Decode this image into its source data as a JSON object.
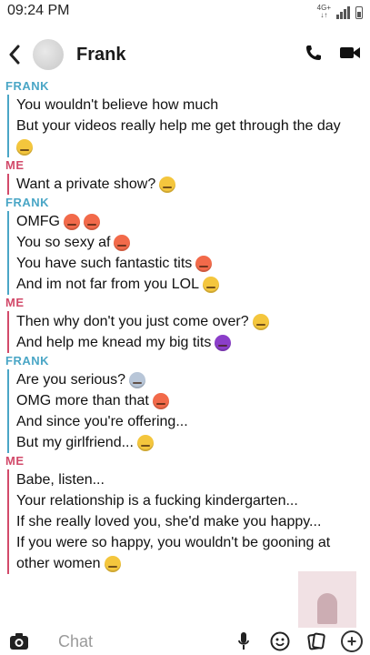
{
  "status_bar": {
    "time": "09:24 PM",
    "network": "4G+"
  },
  "header": {
    "contact_name": "Frank"
  },
  "messages": [
    {
      "sender": "FRANK",
      "from": "frank",
      "lines": [
        {
          "text": "You wouldn't believe how much",
          "emojis": []
        },
        {
          "text": "But your videos really help me get through the day",
          "emojis": []
        },
        {
          "text": "",
          "emojis": [
            "grin"
          ]
        }
      ]
    },
    {
      "sender": "ME",
      "from": "me",
      "lines": [
        {
          "text": "Want a private show?",
          "emojis": [
            "smirk"
          ]
        }
      ]
    },
    {
      "sender": "FRANK",
      "from": "frank",
      "lines": [
        {
          "text": "OMFG",
          "emojis": [
            "flushed",
            "flushed"
          ]
        },
        {
          "text": "You so sexy af",
          "emojis": [
            "flushed"
          ]
        },
        {
          "text": "You have such fantastic tits",
          "emojis": [
            "flushed"
          ]
        },
        {
          "text": "And im not far from you LOL",
          "emojis": [
            "grin"
          ]
        }
      ]
    },
    {
      "sender": "ME",
      "from": "me",
      "lines": [
        {
          "text": "Then why don't you just come over?",
          "emojis": [
            "smirk"
          ]
        },
        {
          "text": "And help me knead my big tits",
          "emojis": [
            "devil"
          ]
        }
      ]
    },
    {
      "sender": "FRANK",
      "from": "frank",
      "lines": [
        {
          "text": "Are you serious?",
          "emojis": [
            "scream"
          ]
        },
        {
          "text": "OMG more than that",
          "emojis": [
            "flushed"
          ]
        },
        {
          "text": "And since you're offering...",
          "emojis": []
        },
        {
          "text": "But my girlfriend...",
          "emojis": [
            "grimace"
          ]
        }
      ]
    },
    {
      "sender": "ME",
      "from": "me",
      "lines": [
        {
          "text": "Babe, listen...",
          "emojis": []
        },
        {
          "text": "Your relationship is a fucking kindergarten...",
          "emojis": []
        },
        {
          "text": "If she really loved you, she'd make you happy...",
          "emojis": []
        },
        {
          "text": "If you were so happy, you wouldn't be gooning at",
          "emojis": []
        },
        {
          "text": "other women",
          "emojis": [
            "smirk"
          ]
        }
      ]
    }
  ],
  "chat_bar": {
    "placeholder": "Chat"
  },
  "icons": {
    "back": "chevron-left-icon",
    "call": "phone-icon",
    "video": "video-camera-icon",
    "camera": "camera-icon",
    "mic": "microphone-icon",
    "emoji": "emoji-icon",
    "cards": "cards-icon",
    "plus": "plus-icon"
  },
  "colors": {
    "frank": "#4aa6c6",
    "me": "#d24a6a"
  }
}
